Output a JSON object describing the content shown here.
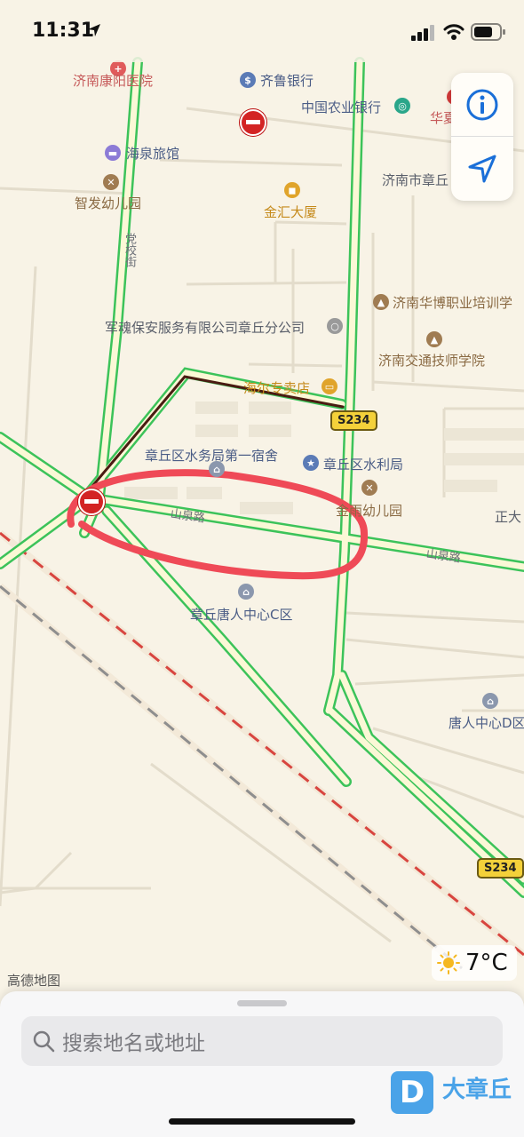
{
  "status_bar": {
    "time": "11:31"
  },
  "map": {
    "labels": {
      "kangyang_hospital": "济南康阳医院",
      "qilu_bank": "齐鲁银行",
      "abc_bank": "中国农业银行",
      "huaxia": "华夏",
      "haiquan_hotel": "海泉旅馆",
      "zhifa_kindergarten": "智发幼儿园",
      "jinhui_building": "金汇大厦",
      "jinan_zhangqiu": "济南市章丘",
      "dangxiao_street": "党校街",
      "security_company": "军魂保安服务有限公司章丘分公司",
      "huabo_school": "济南华博职业培训学",
      "jiaotong_college": "济南交通技师学院",
      "haier_store": "海尔专卖店",
      "water_dorm": "章丘区水务局第一宿舍",
      "water_bureau": "章丘区水利局",
      "jinyu_kindergarten": "金雨幼儿园",
      "shanquan_road_west": "山泉路",
      "shanquan_road_east": "山泉路",
      "tangren_c": "章丘唐人中心C区",
      "tangren_d": "唐人中心D区",
      "zhengda": "正大"
    },
    "highway_shields": [
      "S234",
      "S234"
    ],
    "watermark": "高德地图",
    "weather": {
      "temperature": "7°C",
      "icon": "sun-icon"
    }
  },
  "search": {
    "placeholder": "搜索地名或地址"
  },
  "brand": {
    "letter": "D",
    "name": "大章丘"
  },
  "colors": {
    "map_background": "#f8f3e6",
    "road_green": "#3cc35a",
    "route_dark": "#4a1c12",
    "highlight_circle": "#ef4a57",
    "accent_blue": "#1a6fd8"
  }
}
